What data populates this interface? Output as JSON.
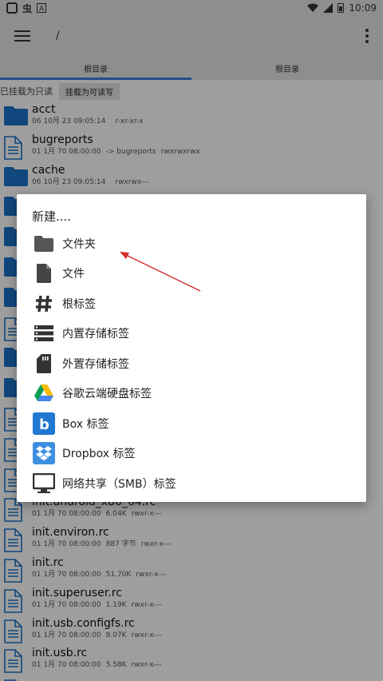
{
  "status_bar": {
    "glyph": "虫",
    "time": "10:09"
  },
  "toolbar": {
    "path": "/"
  },
  "tabs": [
    {
      "label": "根目录",
      "active": true
    },
    {
      "label": "根目录",
      "active": false
    }
  ],
  "mount": {
    "status": "已挂载为只读",
    "button": "挂载为可读写"
  },
  "files": [
    {
      "name": "acct",
      "type": "folder",
      "date": "06 10月 23 09:05:14",
      "info": "",
      "perm": "r-xr-xr-x"
    },
    {
      "name": "bugreports",
      "type": "file",
      "date": "01 1月 70 08:00:00",
      "info": "-> bugreports",
      "perm": "rwxrwxrwx"
    },
    {
      "name": "cache",
      "type": "folder",
      "date": "06 10月 23 09:05:14",
      "info": "",
      "perm": "rwxrwx---"
    },
    {
      "name": "",
      "type": "folder",
      "date": "",
      "info": "",
      "perm": ""
    },
    {
      "name": "",
      "type": "folder",
      "date": "",
      "info": "",
      "perm": ""
    },
    {
      "name": "",
      "type": "folder",
      "date": "",
      "info": "",
      "perm": ""
    },
    {
      "name": "",
      "type": "folder",
      "date": "",
      "info": "",
      "perm": ""
    },
    {
      "name": "",
      "type": "file",
      "date": "",
      "info": "",
      "perm": ""
    },
    {
      "name": "",
      "type": "folder",
      "date": "",
      "info": "",
      "perm": ""
    },
    {
      "name": "",
      "type": "folder",
      "date": "",
      "info": "",
      "perm": ""
    },
    {
      "name": "",
      "type": "file",
      "date": "",
      "info": "",
      "perm": ""
    },
    {
      "name": "",
      "type": "file",
      "date": "",
      "info": "",
      "perm": ""
    },
    {
      "name": "",
      "type": "file",
      "date": "",
      "info": "",
      "perm": ""
    },
    {
      "name": "init.android_x86_64.rc",
      "type": "file",
      "date": "01 1月 70 08:00:00",
      "info": "6.04K",
      "perm": "rwxr-x---"
    },
    {
      "name": "init.environ.rc",
      "type": "file",
      "date": "01 1月 70 08:00:00",
      "info": "887 字节",
      "perm": "rwxr-x---"
    },
    {
      "name": "init.rc",
      "type": "file",
      "date": "01 1月 70 08:00:00",
      "info": "51.70K",
      "perm": "rwxr-x---"
    },
    {
      "name": "init.superuser.rc",
      "type": "file",
      "date": "01 1月 70 08:00:00",
      "info": "1.19K",
      "perm": "rwxr-x---"
    },
    {
      "name": "init.usb.configfs.rc",
      "type": "file",
      "date": "01 1月 70 08:00:00",
      "info": "9.07K",
      "perm": "rwxr-x---"
    },
    {
      "name": "init.usb.rc",
      "type": "file",
      "date": "01 1月 70 08:00:00",
      "info": "5.58K",
      "perm": "rwxr-x---"
    },
    {
      "name": "",
      "type": "file",
      "date": "",
      "info": "",
      "perm": ""
    }
  ],
  "dialog": {
    "title": "新建....",
    "items": [
      {
        "label": "文件夹",
        "icon": "folder-icon"
      },
      {
        "label": "文件",
        "icon": "file-icon"
      },
      {
        "label": "根标签",
        "icon": "hash-icon"
      },
      {
        "label": "内置存储标签",
        "icon": "storage-icon"
      },
      {
        "label": "外置存储标签",
        "icon": "sd-card-icon"
      },
      {
        "label": "谷歌云端硬盘标签",
        "icon": "google-drive-icon"
      },
      {
        "label": "Box 标签",
        "icon": "box-icon"
      },
      {
        "label": "Dropbox 标签",
        "icon": "dropbox-icon"
      },
      {
        "label": "网络共享（SMB）标签",
        "icon": "monitor-icon"
      }
    ]
  },
  "colors": {
    "folder": "#1a73c8",
    "file": "#1a73c8",
    "accent": "#3a7ee0",
    "arrow": "#d32f2f"
  }
}
